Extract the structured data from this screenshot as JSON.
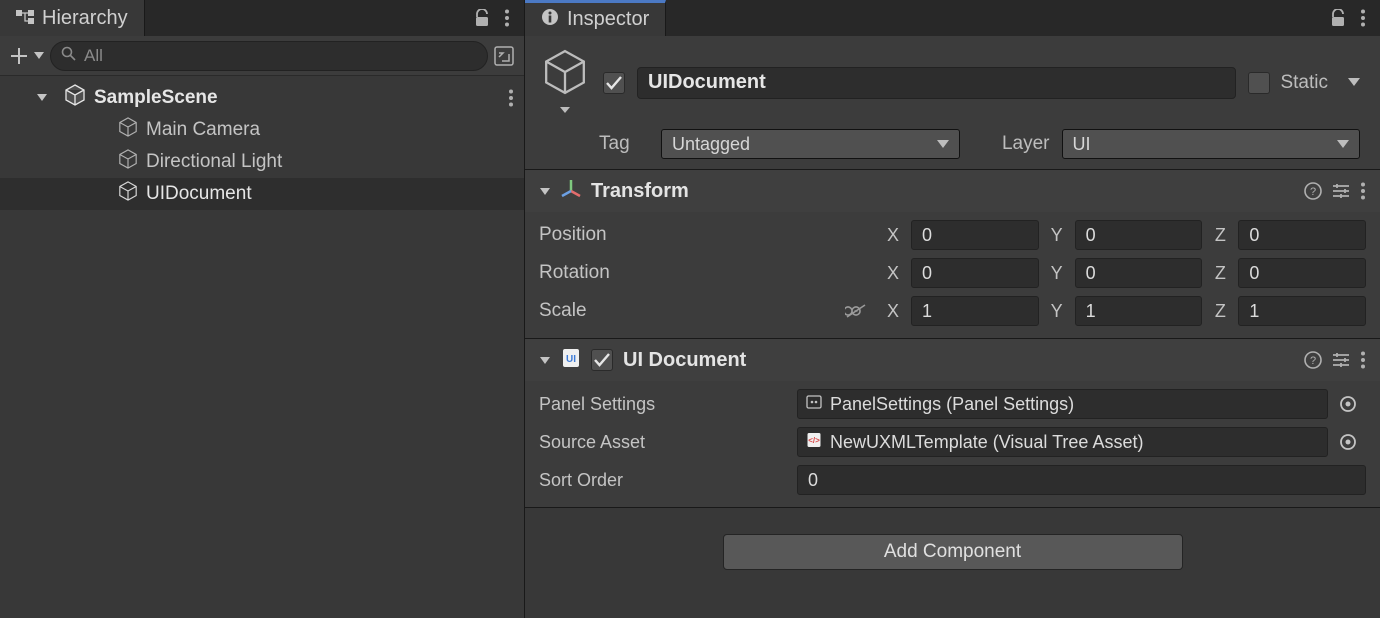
{
  "hierarchy": {
    "tab_label": "Hierarchy",
    "search_placeholder": "All",
    "scene_name": "SampleScene",
    "items": [
      {
        "label": "Main Camera"
      },
      {
        "label": "Directional Light"
      },
      {
        "label": "UIDocument"
      }
    ]
  },
  "inspector": {
    "tab_label": "Inspector",
    "object_name": "UIDocument",
    "static_label": "Static",
    "tag_label": "Tag",
    "tag_value": "Untagged",
    "layer_label": "Layer",
    "layer_value": "UI",
    "transform": {
      "title": "Transform",
      "position_label": "Position",
      "rotation_label": "Rotation",
      "scale_label": "Scale",
      "x_label": "X",
      "y_label": "Y",
      "z_label": "Z",
      "position": {
        "x": "0",
        "y": "0",
        "z": "0"
      },
      "rotation": {
        "x": "0",
        "y": "0",
        "z": "0"
      },
      "scale": {
        "x": "1",
        "y": "1",
        "z": "1"
      }
    },
    "uidoc": {
      "title": "UI Document",
      "panel_settings_label": "Panel Settings",
      "panel_settings_value": "PanelSettings (Panel Settings)",
      "source_asset_label": "Source Asset",
      "source_asset_value": "NewUXMLTemplate (Visual Tree Asset)",
      "sort_order_label": "Sort Order",
      "sort_order_value": "0"
    },
    "add_component_label": "Add Component"
  }
}
